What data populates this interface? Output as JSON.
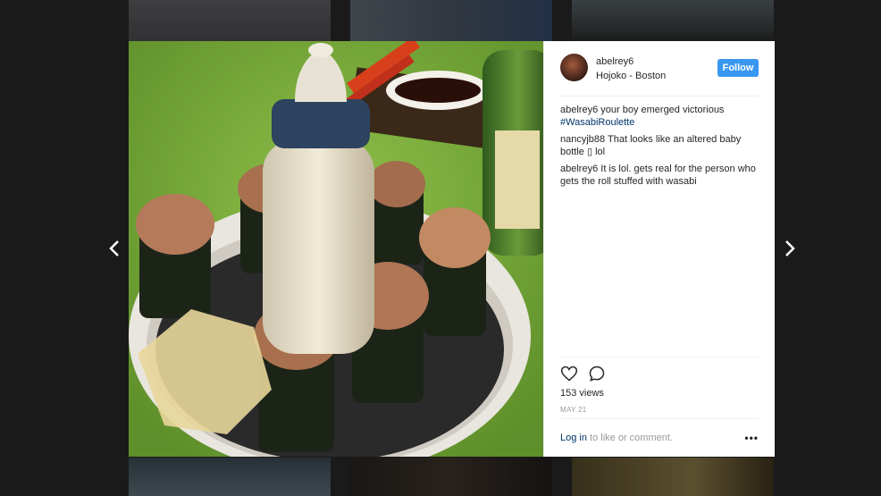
{
  "post": {
    "username": "abelrey6",
    "location": "Hojoko - Boston",
    "follow_label": "Follow",
    "views": "153 views",
    "date": "MAY 21",
    "login_link": "Log in",
    "login_rest": " to like or comment.",
    "more_label": "•••"
  },
  "comments": [
    {
      "user": "abelrey6",
      "text": " your boy emerged victorious ",
      "tag": "#WasabiRoulette"
    },
    {
      "user": "nancyjb88",
      "text": " That looks like an altered baby bottle ▯ lol",
      "tag": ""
    },
    {
      "user": "abelrey6",
      "text": " It is lol. gets real for the person who gets the roll stuffed with wasabi",
      "tag": ""
    }
  ],
  "icons": {
    "prev": "chevron-left-icon",
    "next": "chevron-right-icon",
    "like": "heart-icon",
    "comment": "comment-icon",
    "more": "more-icon"
  },
  "colors": {
    "follow_bg": "#3897f0",
    "link": "#003569",
    "overlay": "#3a3a3a"
  }
}
